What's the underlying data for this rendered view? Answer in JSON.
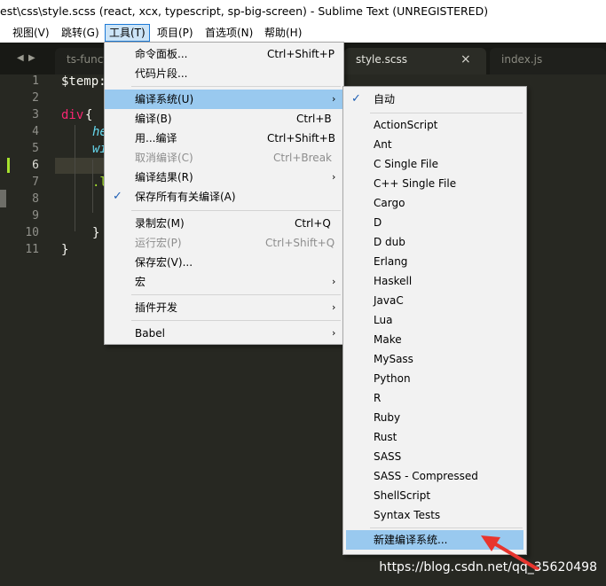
{
  "window": {
    "title": "est\\css\\style.scss (react, xcx, typescript, sp-big-screen) - Sublime Text (UNREGISTERED)"
  },
  "menubar": {
    "items": [
      "视图(V)",
      "跳转(G)",
      "工具(T)",
      "项目(P)",
      "首选项(N)",
      "帮助(H)"
    ],
    "active_index": 2
  },
  "tabs": [
    {
      "label": "ts-functio",
      "active": false
    },
    {
      "label": "style.scss",
      "active": true,
      "close": "×"
    },
    {
      "label": "index.js",
      "active": false
    }
  ],
  "editor": {
    "line_numbers": [
      "1",
      "2",
      "3",
      "4",
      "5",
      "6",
      "7",
      "8",
      "9",
      "10",
      "11"
    ],
    "current_line": "6",
    "code": {
      "line1": "$temp:",
      "line3_tag": "div",
      "line3_brace": "{",
      "line4": "he",
      "line5": "wi",
      "line7": ".l",
      "line10": "}",
      "line11": "}"
    },
    "colors": {
      "background": "#272822",
      "variable": "#f8f8f2",
      "tag": "#f92672",
      "property": "#66d9ef"
    }
  },
  "tools_menu": {
    "items": [
      {
        "label": "命令面板...",
        "shortcut": "Ctrl+Shift+P"
      },
      {
        "label": "代码片段..."
      },
      {
        "label": "编译系统(U)",
        "submenu_arrow": "›",
        "highlighted": true
      },
      {
        "label": "编译(B)",
        "shortcut": "Ctrl+B"
      },
      {
        "label": "用...编译",
        "shortcut": "Ctrl+Shift+B"
      },
      {
        "label": "取消编译(C)",
        "shortcut": "Ctrl+Break",
        "disabled": true
      },
      {
        "label": "编译结果(R)",
        "submenu_arrow": "›"
      },
      {
        "label": "保存所有有关编译(A)",
        "checked": true
      },
      {
        "label": "录制宏(M)",
        "shortcut": "Ctrl+Q"
      },
      {
        "label": "运行宏(P)",
        "shortcut": "Ctrl+Shift+Q",
        "disabled": true
      },
      {
        "label": "保存宏(V)..."
      },
      {
        "label": "宏",
        "submenu_arrow": "›"
      },
      {
        "label": "插件开发",
        "submenu_arrow": "›"
      },
      {
        "label": "Babel",
        "submenu_arrow": "›"
      }
    ],
    "check_glyph": "✓"
  },
  "build_system_menu": {
    "items": [
      {
        "label": "自动",
        "checked": true
      },
      {
        "label": "ActionScript"
      },
      {
        "label": "Ant"
      },
      {
        "label": "C Single File"
      },
      {
        "label": "C++ Single File"
      },
      {
        "label": "Cargo"
      },
      {
        "label": "D"
      },
      {
        "label": "D dub"
      },
      {
        "label": "Erlang"
      },
      {
        "label": "Haskell"
      },
      {
        "label": "JavaC"
      },
      {
        "label": "Lua"
      },
      {
        "label": "Make"
      },
      {
        "label": "MySass"
      },
      {
        "label": "Python"
      },
      {
        "label": "R"
      },
      {
        "label": "Ruby"
      },
      {
        "label": "Rust"
      },
      {
        "label": "SASS"
      },
      {
        "label": "SASS - Compressed"
      },
      {
        "label": "ShellScript"
      },
      {
        "label": "Syntax Tests"
      },
      {
        "label": "新建编译系统...",
        "highlighted": true
      }
    ],
    "check_glyph": "✓"
  },
  "watermark": "https://blog.csdn.net/qq_35620498",
  "accent": {
    "highlight": "#99c9ef",
    "arrow": "#e8352e"
  }
}
